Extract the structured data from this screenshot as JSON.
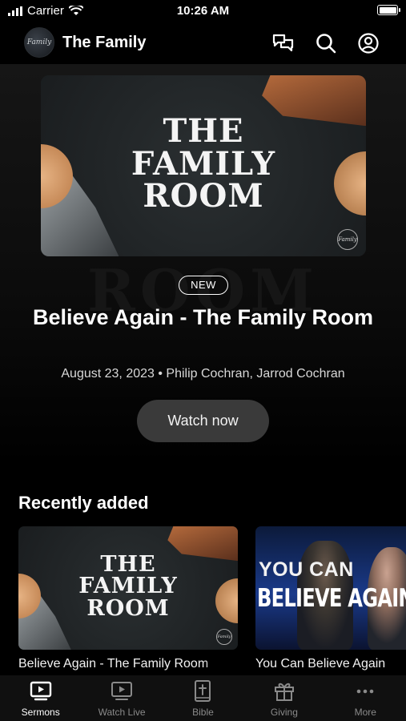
{
  "status_bar": {
    "carrier": "Carrier",
    "time": "10:26 AM",
    "battery_level": 1.0
  },
  "header": {
    "logo_text": "Family",
    "title": "The Family",
    "icons": [
      "chat-bubbles-icon",
      "search-icon",
      "account-icon"
    ]
  },
  "hero": {
    "artwork_lines": [
      "THE",
      "FAMILY",
      "ROOM"
    ],
    "artwork_mark": "Family",
    "background_word": "ROOM",
    "badge": "NEW",
    "title": "Believe Again - The Family Room",
    "meta": "August 23, 2023 • Philip Cochran, Jarrod Cochran",
    "watch_label": "Watch now"
  },
  "recently_added": {
    "title": "Recently added",
    "items": [
      {
        "label": "Believe Again - The Family Room",
        "artwork_lines": [
          "THE",
          "FAMILY",
          "ROOM"
        ],
        "artwork_mark": "Family"
      },
      {
        "label": "You Can Believe Again",
        "artwork_lines": [
          "YOU CAN",
          "BELIEVE AGAIN"
        ]
      }
    ]
  },
  "tabs": [
    {
      "label": "Sermons",
      "icon": "tv-play-icon",
      "active": true
    },
    {
      "label": "Watch Live",
      "icon": "live-tv-icon",
      "active": false
    },
    {
      "label": "Bible",
      "icon": "bible-icon",
      "active": false
    },
    {
      "label": "Giving",
      "icon": "gift-icon",
      "active": false
    },
    {
      "label": "More",
      "icon": "more-dots-icon",
      "active": false
    }
  ]
}
